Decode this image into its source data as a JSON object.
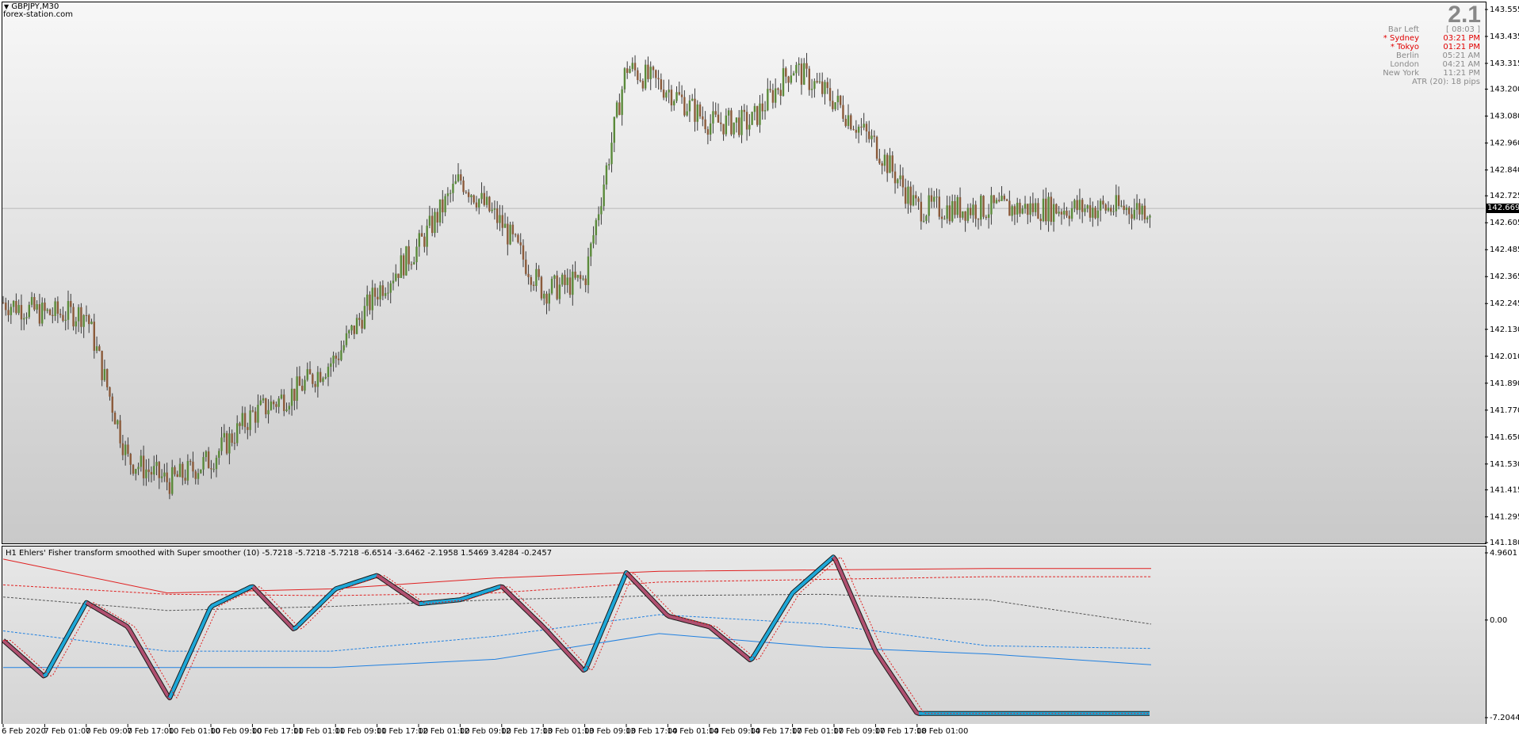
{
  "window": {
    "symbol_label": "GBPJPY,M30",
    "source_label": "forex-station.com"
  },
  "info_panel": {
    "big_number": "2.1",
    "rows": [
      {
        "label": "Bar Left",
        "value": "[ 08:03 ]",
        "color": "grey"
      },
      {
        "label": "* Sydney",
        "value": "03:21 PM",
        "color": "red"
      },
      {
        "label": "* Tokyo",
        "value": "01:21 PM",
        "color": "red"
      },
      {
        "label": "Berlin",
        "value": "05:21 AM",
        "color": "grey"
      },
      {
        "label": "London",
        "value": "04:21 AM",
        "color": "grey"
      },
      {
        "label": "New York",
        "value": "11:21 PM",
        "color": "grey"
      }
    ],
    "atr": "ATR (20): 18 pips"
  },
  "price_axis": {
    "labels": [
      "143.555",
      "143.435",
      "143.315",
      "143.200",
      "143.080",
      "142.960",
      "142.840",
      "142.725",
      "142.605",
      "142.485",
      "142.365",
      "142.245",
      "142.130",
      "142.010",
      "141.890",
      "141.770",
      "141.650",
      "141.530",
      "141.415",
      "141.295",
      "141.180"
    ],
    "current_price": "142.669"
  },
  "indicator": {
    "title": "H1  Ehlers' Fisher transform smoothed with Super smoother (10) -5.7218 -5.7218 -5.7218 -6.6514 -3.6462 -2.1958 1.5469 3.4284 -0.2457",
    "axis_labels": [
      "4.9601",
      "0.00",
      "-7.2044"
    ]
  },
  "time_axis": {
    "labels": [
      "6 Feb 2020",
      "7 Feb 01:00",
      "7 Feb 09:00",
      "7 Feb 17:00",
      "10 Feb 01:00",
      "10 Feb 09:00",
      "10 Feb 17:00",
      "11 Feb 01:00",
      "11 Feb 09:00",
      "11 Feb 17:00",
      "12 Feb 01:00",
      "12 Feb 09:00",
      "12 Feb 17:00",
      "13 Feb 01:00",
      "13 Feb 09:00",
      "13 Feb 17:00",
      "14 Feb 01:00",
      "14 Feb 09:00",
      "14 Feb 17:00",
      "17 Feb 01:00",
      "17 Feb 09:00",
      "17 Feb 17:00",
      "18 Feb 01:00"
    ]
  },
  "colors": {
    "bull_candle": "#5a8a3a",
    "bear_candle": "#8b5a3a",
    "fisher_up": "#1ea8d8",
    "fisher_down": "#b05070",
    "level_red": "#e02020",
    "level_blue": "#2080e0",
    "level_grey": "#555555",
    "bar_left_grey": "#8a8a8a",
    "session_red": "#e00000"
  },
  "chart_data": {
    "type": "candlestick",
    "title": "GBPJPY,M30",
    "ylim": [
      141.18,
      143.555
    ],
    "x_range": [
      "6 Feb 2020",
      "18 Feb 01:00"
    ],
    "close_path": [
      [
        "6 Feb 2020",
        142.25
      ],
      [
        "7 Feb 01:00",
        142.2
      ],
      [
        "7 Feb 09:00",
        142.2
      ],
      [
        "7 Feb 17:00",
        141.55
      ],
      [
        "10 Feb 01:00",
        141.45
      ],
      [
        "10 Feb 09:00",
        141.55
      ],
      [
        "10 Feb 17:00",
        141.75
      ],
      [
        "11 Feb 01:00",
        141.85
      ],
      [
        "11 Feb 09:00",
        142.0
      ],
      [
        "11 Feb 17:00",
        142.3
      ],
      [
        "12 Feb 01:00",
        142.5
      ],
      [
        "12 Feb 09:00",
        142.8
      ],
      [
        "12 Feb 17:00",
        142.6
      ],
      [
        "13 Feb 01:00",
        142.3
      ],
      [
        "13 Feb 09:00",
        142.35
      ],
      [
        "13 Feb 17:00",
        143.3
      ],
      [
        "14 Feb 01:00",
        143.2
      ],
      [
        "14 Feb 09:00",
        143.05
      ],
      [
        "14 Feb 17:00",
        143.05
      ],
      [
        "17 Feb 01:00",
        143.3
      ],
      [
        "17 Feb 09:00",
        143.15
      ],
      [
        "17 Feb 17:00",
        142.95
      ],
      [
        "18 Feb 01:00",
        142.669
      ]
    ],
    "indicator": {
      "type": "line",
      "name": "Ehlers' Fisher transform smoothed with Super smoother (10)",
      "ylim": [
        -7.2044,
        4.9601
      ],
      "fisher": [
        [
          "6 Feb 2020",
          -1.5
        ],
        [
          "7 Feb 01:00",
          -4.2
        ],
        [
          "7 Feb 09:00",
          1.3
        ],
        [
          "7 Feb 17:00",
          -0.5
        ],
        [
          "10 Feb 01:00",
          -5.8
        ],
        [
          "10 Feb 09:00",
          1.0
        ],
        [
          "10 Feb 17:00",
          2.5
        ],
        [
          "11 Feb 01:00",
          -0.7
        ],
        [
          "11 Feb 09:00",
          2.3
        ],
        [
          "11 Feb 17:00",
          3.3
        ],
        [
          "12 Feb 01:00",
          1.2
        ],
        [
          "12 Feb 09:00",
          1.5
        ],
        [
          "12 Feb 17:00",
          2.5
        ],
        [
          "13 Feb 01:00",
          -0.5
        ],
        [
          "13 Feb 09:00",
          -3.8
        ],
        [
          "13 Feb 17:00",
          3.5
        ],
        [
          "14 Feb 01:00",
          0.3
        ],
        [
          "14 Feb 09:00",
          -0.5
        ],
        [
          "14 Feb 17:00",
          -3.0
        ],
        [
          "17 Feb 01:00",
          2.0
        ],
        [
          "17 Feb 09:00",
          4.7
        ],
        [
          "17 Feb 17:00",
          -2.3
        ],
        [
          "18 Feb 01:00",
          -6.9
        ]
      ],
      "levels": [
        {
          "color": "red",
          "style": "solid",
          "values": [
            4.5,
            2.0,
            2.3,
            3.1,
            3.6,
            3.7,
            3.8,
            3.8
          ]
        },
        {
          "color": "red",
          "style": "dashed",
          "values": [
            2.6,
            1.9,
            1.8,
            2.0,
            2.8,
            3.0,
            3.2,
            3.2
          ]
        },
        {
          "color": "grey",
          "style": "dashed",
          "values": [
            1.7,
            0.7,
            1.0,
            1.5,
            1.8,
            1.9,
            1.5,
            -0.3
          ]
        },
        {
          "color": "blue",
          "style": "dashed",
          "values": [
            -0.8,
            -2.3,
            -2.3,
            -1.2,
            0.4,
            -0.3,
            -1.9,
            -2.1
          ]
        },
        {
          "color": "blue",
          "style": "solid",
          "values": [
            -3.5,
            -3.5,
            -3.5,
            -2.9,
            -1.0,
            -2.0,
            -2.5,
            -3.3
          ]
        }
      ]
    }
  }
}
